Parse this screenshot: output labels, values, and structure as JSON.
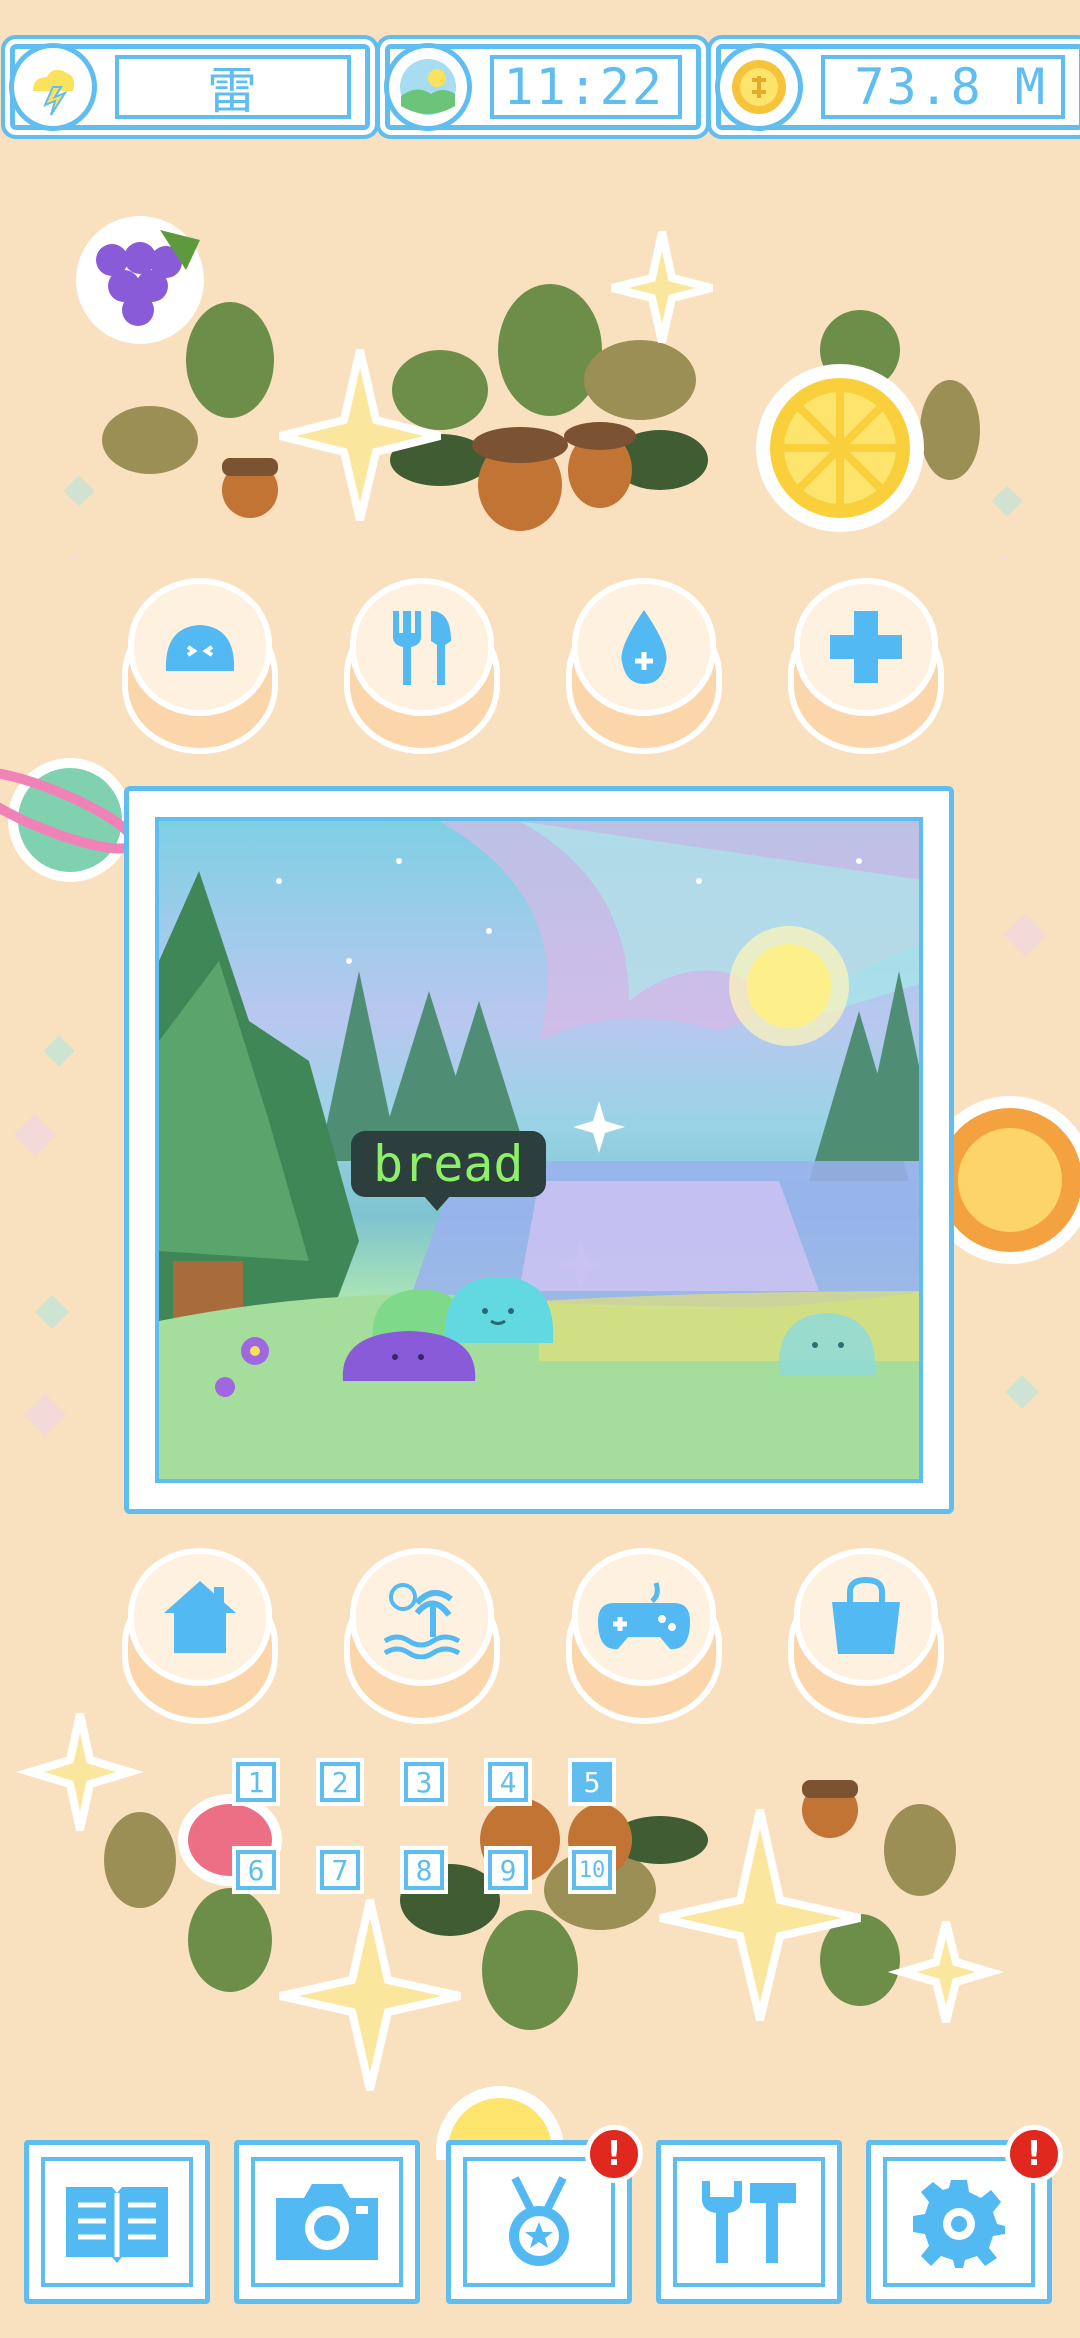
{
  "status": {
    "weather": {
      "icon": "lightning-cloud-icon",
      "label": "雷"
    },
    "time": {
      "icon": "landscape-sun-icon",
      "label": "11:22"
    },
    "currency": {
      "icon": "coin-icon",
      "label": "73.8 M"
    }
  },
  "care_actions": [
    {
      "icon": "slime-icon",
      "name": "pet"
    },
    {
      "icon": "fork-knife-icon",
      "name": "feed"
    },
    {
      "icon": "water-drop-icon",
      "name": "water"
    },
    {
      "icon": "plus-icon",
      "name": "heal"
    }
  ],
  "scene": {
    "speech": "bread"
  },
  "location_actions": [
    {
      "icon": "house-icon",
      "name": "home"
    },
    {
      "icon": "island-icon",
      "name": "travel"
    },
    {
      "icon": "gamepad-icon",
      "name": "play"
    },
    {
      "icon": "shopping-bag-icon",
      "name": "shop"
    }
  ],
  "pages": [
    "1",
    "2",
    "3",
    "4",
    "5",
    "6",
    "7",
    "8",
    "9",
    "10"
  ],
  "active_page": "5",
  "toolbar": [
    {
      "icon": "book-icon",
      "badge": ""
    },
    {
      "icon": "camera-icon",
      "badge": ""
    },
    {
      "icon": "medal-icon",
      "badge": "!"
    },
    {
      "icon": "tools-icon",
      "badge": ""
    },
    {
      "icon": "gear-icon",
      "badge": "!"
    }
  ],
  "colors": {
    "accent": "#60bdf0",
    "background": "#f9e0bf",
    "badge": "#e0281f",
    "speech_text": "#8ef06a"
  }
}
